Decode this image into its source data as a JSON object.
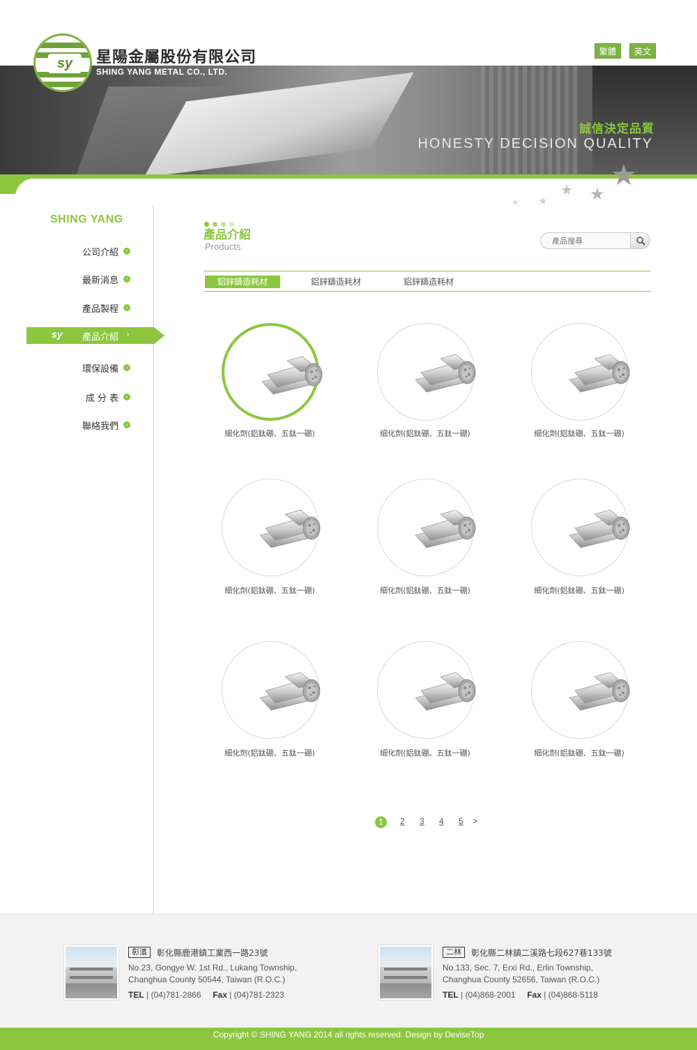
{
  "header": {
    "brand_cn": "星陽金屬股份有限公司",
    "brand_en": "SHING YANG METAL CO., LTD.",
    "logo_mark": "sy",
    "lang_tw": "繁體",
    "lang_en": "英文",
    "slogan_cn": "誠信決定品質",
    "slogan_en": "HONESTY DECISION QUALITY"
  },
  "sidebar": {
    "title": "SHING YANG",
    "active_mark": "sy",
    "items": [
      {
        "label": "公司介紹"
      },
      {
        "label": "最新消息"
      },
      {
        "label": "產品製程"
      },
      {
        "label": "產品介紹"
      },
      {
        "label": "環保設備"
      },
      {
        "label": "成 分 表"
      },
      {
        "label": "聯絡我們"
      }
    ]
  },
  "main": {
    "title": "產品介紹",
    "subtitle": "Products",
    "search_placeholder": "產品搜尋",
    "tabs": [
      {
        "label": "鋁鋅鑄造耗材"
      },
      {
        "label": "鋁鋅鑄造耗材"
      },
      {
        "label": "鋁鋅鑄造耗材"
      }
    ],
    "products": [
      {
        "name": "細化劑(鋁鈦硼、五鈦一硼)"
      },
      {
        "name": "細化劑(鋁鈦硼、五鈦一硼)"
      },
      {
        "name": "細化劑(鋁鈦硼、五鈦一硼)"
      },
      {
        "name": "細化劑(鋁鈦硼、五鈦一硼)"
      },
      {
        "name": "細化劑(鋁鈦硼、五鈦一硼)"
      },
      {
        "name": "細化劑(鋁鈦硼、五鈦一硼)"
      },
      {
        "name": "細化劑(鋁鈦硼、五鈦一硼)"
      },
      {
        "name": "細化劑(鋁鈦硼、五鈦一硼)"
      },
      {
        "name": "細化劑(鋁鈦硼、五鈦一硼)"
      }
    ],
    "pagination": [
      "1",
      "2",
      "3",
      "4",
      "5",
      ">"
    ]
  },
  "footer": {
    "offices": [
      {
        "tag": "彰濱",
        "addr_cn": "彰化縣鹿港鎮工業西一路23號",
        "addr_en_1": "No.23, Gongye W. 1st Rd., Lukang Township,",
        "addr_en_2": "Changhua County 50544, Taiwan (R.O.C.)",
        "tel_label": "TEL",
        "tel": " | (04)781-2866",
        "fax_label": "Fax",
        "fax": " | (04)781-2323"
      },
      {
        "tag": "二林",
        "addr_cn": "彰化縣二林鎮二溪路七段627巷133號",
        "addr_en_1": "No.133, Sec. 7, Erxi Rd., Erlin Township,",
        "addr_en_2": "Changhua County 52656, Taiwan (R.O.C.)",
        "tel_label": "TEL",
        "tel": " | (04)868-2001",
        "fax_label": "Fax",
        "fax": " | (04)868-5118"
      }
    ],
    "copyright": "Copyright © SHING YANG 2014 all rights reserved. Design by DeviseTop"
  },
  "colors": {
    "accent": "#8cc63f",
    "text": "#333333",
    "muted": "#999999",
    "footer_bg": "#f2f2f2"
  }
}
